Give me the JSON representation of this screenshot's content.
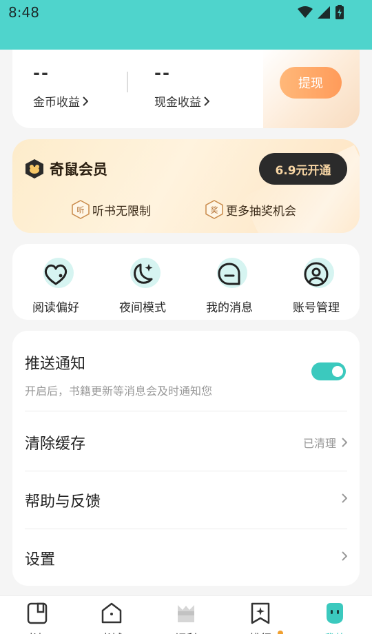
{
  "status_bar": {
    "time": "8:48"
  },
  "earnings": {
    "coin_value": "--",
    "coin_label": "金币收益",
    "cash_value": "--",
    "cash_label": "现金收益",
    "withdraw_label": "提现"
  },
  "vip": {
    "title": "奇鼠会员",
    "open_label": "6.9元开通",
    "perks": [
      {
        "icon_char": "听",
        "text": "听书无限制"
      },
      {
        "icon_char": "奖",
        "text": "更多抽奖机会"
      }
    ]
  },
  "quick_actions": [
    {
      "label": "阅读偏好",
      "icon": "heart-icon"
    },
    {
      "label": "夜间模式",
      "icon": "moon-icon"
    },
    {
      "label": "我的消息",
      "icon": "message-icon"
    },
    {
      "label": "账号管理",
      "icon": "account-icon"
    }
  ],
  "settings": {
    "push": {
      "title": "推送通知",
      "subtitle": "开启后，书籍更新等消息会及时通知您",
      "enabled": true
    },
    "cache": {
      "title": "清除缓存",
      "status": "已清理"
    },
    "help": {
      "title": "帮助与反馈"
    },
    "settings": {
      "title": "设置"
    }
  },
  "bottom_nav": [
    {
      "label": "书架",
      "icon": "bookshelf-icon"
    },
    {
      "label": "书城",
      "icon": "bookstore-icon"
    },
    {
      "label": "福利",
      "icon": "welfare-icon"
    },
    {
      "label": "排行",
      "icon": "ranking-icon"
    },
    {
      "label": "我的",
      "icon": "profile-icon",
      "active": true
    }
  ],
  "colors": {
    "accent": "#3bc9be",
    "status_bar": "#4fd4cc",
    "withdraw": "#ff9b5a",
    "vip_button": "#2b2b2b"
  }
}
